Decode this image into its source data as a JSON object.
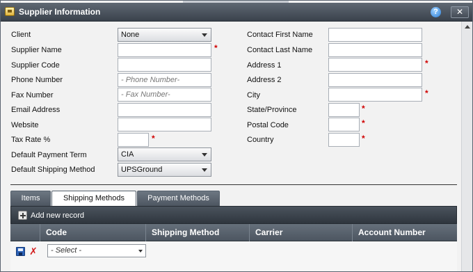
{
  "window": {
    "title": "Supplier Information",
    "help_symbol": "?",
    "close_symbol": "✕"
  },
  "form_left": {
    "client_label": "Client",
    "client_value": "None",
    "supplier_name_label": "Supplier Name",
    "supplier_code_label": "Supplier Code",
    "phone_label": "Phone Number",
    "phone_placeholder": "- Phone Number-",
    "fax_label": "Fax Number",
    "fax_placeholder": "- Fax Number-",
    "email_label": "Email Address",
    "website_label": "Website",
    "tax_rate_label": "Tax Rate %",
    "payment_term_label": "Default Payment Term",
    "payment_term_value": "CIA",
    "shipping_method_label": "Default Shipping Method",
    "shipping_method_value": "UPSGround"
  },
  "form_right": {
    "first_name_label": "Contact First Name",
    "last_name_label": "Contact Last Name",
    "address1_label": "Address 1",
    "address2_label": "Address 2",
    "city_label": "City",
    "state_label": "State/Province",
    "postal_label": "Postal Code",
    "country_label": "Country"
  },
  "required_marker": "*",
  "tabs": [
    {
      "label": "Items",
      "active": false
    },
    {
      "label": "Shipping Methods",
      "active": true
    },
    {
      "label": "Payment Methods",
      "active": false
    }
  ],
  "grid": {
    "add_label": "Add new record",
    "columns": [
      "Code",
      "Shipping Method",
      "Carrier",
      "Account Number"
    ],
    "row_select_placeholder": "- Select -"
  },
  "icons": {
    "app": "supplier-window-icon",
    "help": "help-icon",
    "close": "close-icon",
    "add": "add-icon",
    "save": "save-icon",
    "cancel": "cancel-icon",
    "dropdown": "chevron-down-icon",
    "scroll_up": "scroll-up-arrow-icon"
  },
  "colors": {
    "titlebar": "#4a535d",
    "required": "#d00000",
    "help": "#2a7dd6"
  }
}
